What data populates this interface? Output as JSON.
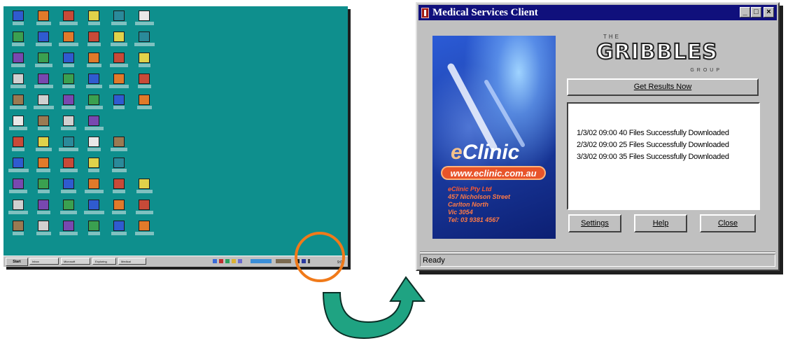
{
  "window": {
    "title": "Medical Services Client",
    "controls": {
      "minimize": "_",
      "maximize": "□",
      "close": "×"
    },
    "status": "Ready"
  },
  "banner": {
    "brand_e": "e",
    "brand_rest": "Clinic",
    "url": "www.eclinic.com.au",
    "address_lines": [
      "eClinic Pty Ltd",
      "457 Nicholson Street",
      "Carlton North",
      "Vic 3054",
      "Tel: 03 9381 4567"
    ]
  },
  "logo": {
    "the": "THE",
    "name": "GRIBBLES",
    "group": "GROUP"
  },
  "buttons": {
    "get_results": "Get Results Now",
    "settings": "Settings",
    "help": "Help",
    "close": "Close"
  },
  "log": [
    "1/3/02 09:00 40 Files Successfully Downloaded",
    "2/3/02 09:00 25 Files Successfully Downloaded",
    "3/3/02 09:00 35 Files Successfully Downloaded"
  ],
  "desktop": {
    "taskbar": {
      "start": "Start",
      "buttons": [
        "Inbox",
        "Microsoft",
        "Exploring",
        "Medical",
        "Program"
      ],
      "clock": "9:00 AM"
    }
  },
  "colors": {
    "desktop": "#0e8f8d",
    "titlebar": "#10107c",
    "highlight": "#f07a1a",
    "arrow": "#1fa382"
  }
}
